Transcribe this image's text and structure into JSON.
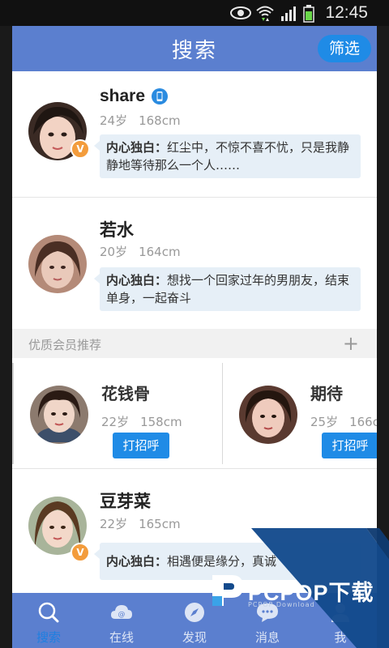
{
  "status": {
    "time": "12:45"
  },
  "header": {
    "title": "搜索",
    "filter_label": "筛选"
  },
  "profiles": [
    {
      "name": "share",
      "age": "24岁",
      "height": "168cm",
      "bio_label": "内心独白：",
      "bio": "红尘中，不惊不喜不忧，只是我静静地等待那么一个人……",
      "vip_badge": "V",
      "verified_icon": "phone-badge-icon"
    },
    {
      "name": "若水",
      "age": "20岁",
      "height": "164cm",
      "bio_label": "内心独白：",
      "bio": "想找一个回家过年的男朋友，结束单身，一起奋斗"
    },
    {
      "name": "豆芽菜",
      "age": "22岁",
      "height": "165cm",
      "bio_label": "内心独白：",
      "bio": "相遇便是缘分，真诚",
      "vip_badge": "V"
    }
  ],
  "recommend": {
    "title": "优质会员推荐",
    "more_icon": "plus-icon",
    "members": [
      {
        "name": "花钱骨",
        "age": "22岁",
        "height": "158cm",
        "greet_label": "打招呼"
      },
      {
        "name": "期待",
        "age": "25岁",
        "height": "166c",
        "greet_label": "打招呼"
      }
    ]
  },
  "tabs": [
    {
      "label": "搜索",
      "icon": "search-icon",
      "active": true
    },
    {
      "label": "在线",
      "icon": "cloud-icon",
      "active": false
    },
    {
      "label": "发现",
      "icon": "compass-icon",
      "active": false
    },
    {
      "label": "消息",
      "icon": "chat-bubble-icon",
      "active": false
    },
    {
      "label": "我",
      "icon": "user-icon",
      "active": false
    }
  ],
  "watermark": {
    "brand": "PCPOP下载",
    "sub": "PCPOP Download"
  },
  "colors": {
    "header": "#5b7fcf",
    "accent": "#1f8be6",
    "vip": "#f39c3c",
    "bio_bg": "#e6eff7",
    "watermark": "#134a8c"
  }
}
